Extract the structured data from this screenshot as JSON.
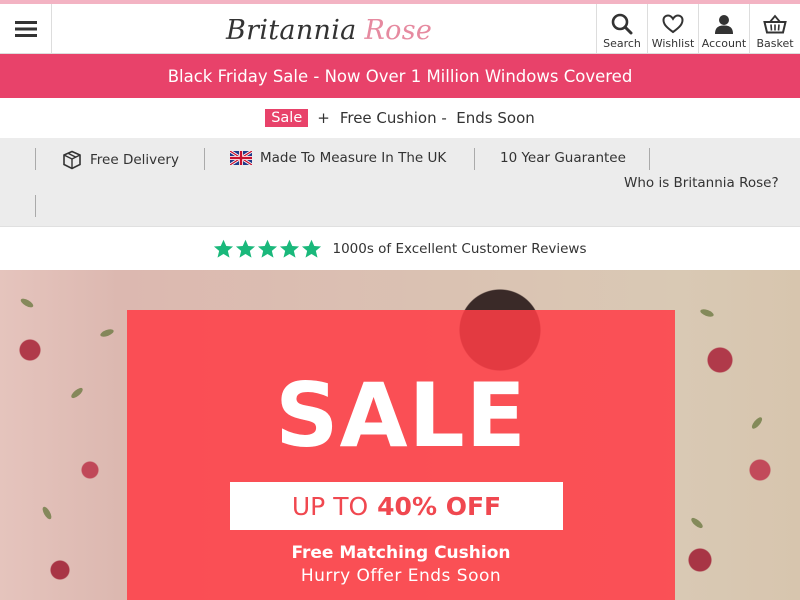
{
  "header": {
    "logo_main": "Britannia",
    "logo_accent": "Rose",
    "icons": [
      {
        "name": "search-icon",
        "label": "Search"
      },
      {
        "name": "heart-icon",
        "label": "Wishlist"
      },
      {
        "name": "user-icon",
        "label": "Account"
      },
      {
        "name": "basket-icon",
        "label": "Basket"
      }
    ]
  },
  "promo_bar": {
    "text": "Black Friday Sale - Now Over 1 Million Windows Covered"
  },
  "sale_line": {
    "tag": "Sale",
    "plus": "+",
    "text": "Free Cushion -  Ends Soon"
  },
  "usps": {
    "delivery": "Free Delivery",
    "made": "Made To Measure In The UK",
    "guarantee": "10 Year Guarantee",
    "who": "Who is Britannia Rose?"
  },
  "reviews": {
    "text": "1000s of Excellent Customer Reviews",
    "stars": 5,
    "star_color": "#1ab87b"
  },
  "hero": {
    "headline": "SALE",
    "offer_prefix": "UP TO",
    "offer_value": "40% OFF",
    "line1": "Free Matching Cushion",
    "line2": "Hurry Offer Ends Soon"
  },
  "colors": {
    "brand_pink": "#e8426a",
    "sale_red": "#ff3c46"
  }
}
